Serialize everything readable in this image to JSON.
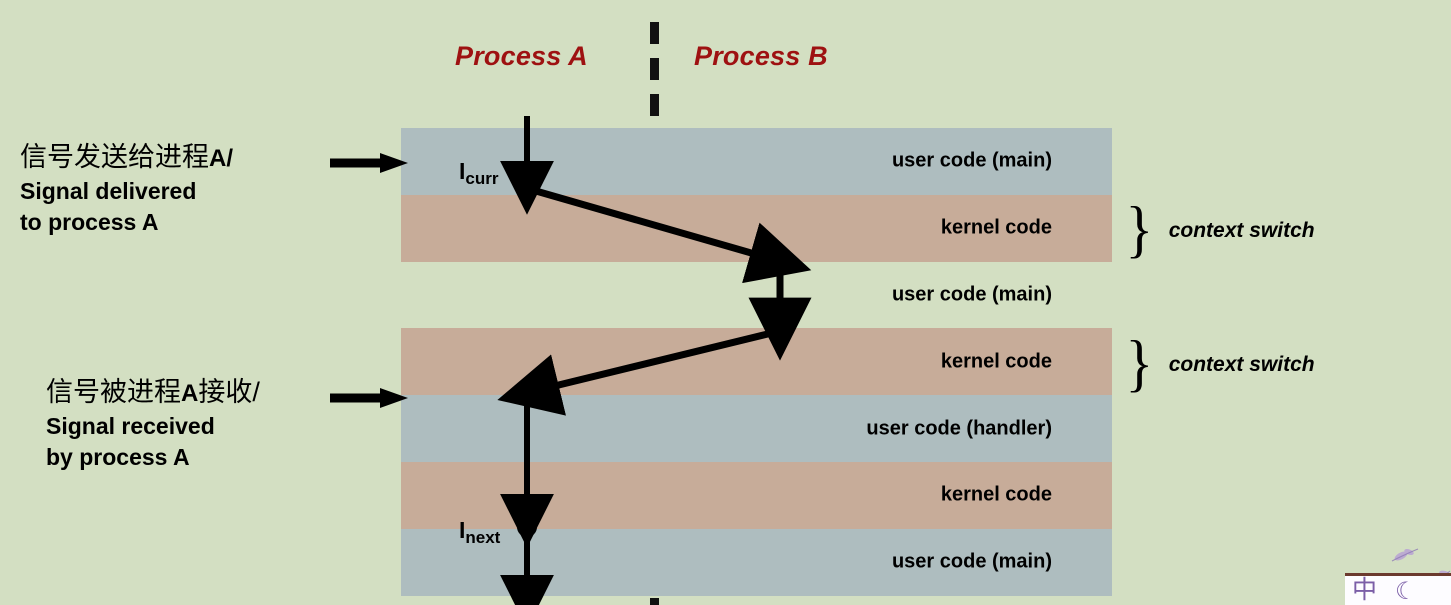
{
  "slide": {
    "background_color": "#d3dfc2",
    "title_color": "#9e1111"
  },
  "columns": [
    {
      "id": "process-a",
      "label": "Process A"
    },
    {
      "id": "process-b",
      "label": "Process B"
    }
  ],
  "bands": [
    {
      "label": "user code (main)",
      "kind": "user",
      "color": "#aebdbf"
    },
    {
      "label": "kernel code",
      "kind": "kernel",
      "color": "#c7ac99"
    },
    {
      "label": "user code (main)",
      "kind": "bg",
      "color": "#d3dfc2"
    },
    {
      "label": "kernel code",
      "kind": "kernel",
      "color": "#c7ac99"
    },
    {
      "label": "user code (handler)",
      "kind": "user",
      "color": "#aebdbf"
    },
    {
      "label": "kernel code",
      "kind": "kernel",
      "color": "#c7ac99"
    },
    {
      "label": "user code (main)",
      "kind": "user",
      "color": "#aebdbf"
    }
  ],
  "callouts": [
    {
      "zh": "信号发送给进程",
      "zh_latin": "A/",
      "en_line1": "Signal delivered",
      "en_line2": "to process A"
    },
    {
      "zh_pre": "信号被进程",
      "zh_latin": "A",
      "zh_post": "接收/",
      "en_line1": "Signal received",
      "en_line2": "by process A"
    }
  ],
  "annotations": {
    "context_switch_label": "context switch",
    "brace_glyph": "}",
    "instruction_curr": "I",
    "instruction_curr_sub": "curr",
    "instruction_next": "I",
    "instruction_next_sub": "next"
  },
  "ime": {
    "mode_label": "中",
    "moon_glyph": "☾"
  }
}
